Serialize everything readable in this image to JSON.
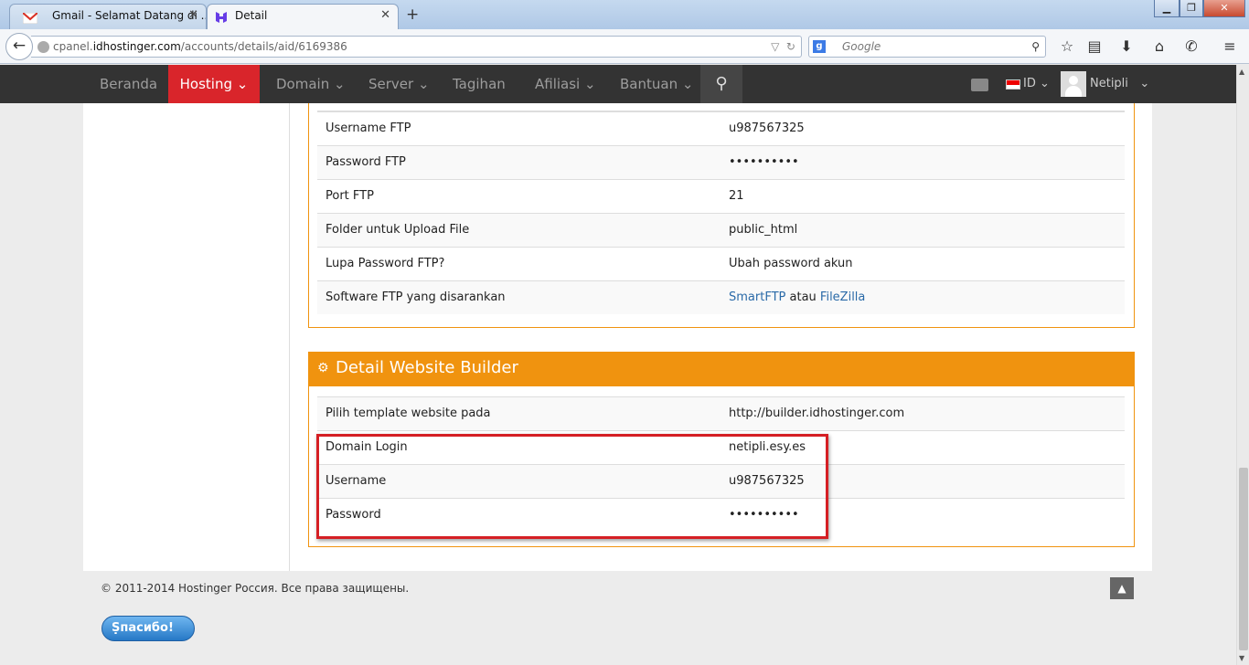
{
  "browser": {
    "tabs": [
      {
        "title": "Gmail - Selamat Datang di ...",
        "icon": "gmail-icon",
        "active": false
      },
      {
        "title": "Detail",
        "icon": "hostinger-icon",
        "active": true
      }
    ],
    "url": {
      "prefix": "cpanel.",
      "domain": "idhostinger.com",
      "path": "/accounts/details/aid/6169386"
    },
    "search_placeholder": "Google"
  },
  "sitenav": {
    "items": [
      {
        "label": "Beranda",
        "dropdown": false
      },
      {
        "label": "Hosting",
        "dropdown": true,
        "active": true
      },
      {
        "label": "Domain",
        "dropdown": true
      },
      {
        "label": "Server",
        "dropdown": true
      },
      {
        "label": "Tagihan",
        "dropdown": false
      },
      {
        "label": "Afiliasi",
        "dropdown": true
      },
      {
        "label": "Bantuan",
        "dropdown": true
      }
    ],
    "language": "ID",
    "username": "Netipli",
    "accent": "#d9252b"
  },
  "ftp": {
    "rows": [
      {
        "label": "Username FTP",
        "value": "u987567325"
      },
      {
        "label": "Password FTP",
        "value": "••••••••••"
      },
      {
        "label": "Port FTP",
        "value": "21"
      },
      {
        "label": "Folder untuk Upload File",
        "value": "public_html"
      },
      {
        "label": "Lupa Password FTP?",
        "value": "Ubah password akun"
      },
      {
        "label": "Software FTP yang disarankan",
        "link1": "SmartFTP",
        "sep": "atau",
        "link2": "FileZilla"
      }
    ]
  },
  "website_builder": {
    "title": "Detail Website Builder",
    "header_color": "#f0930f",
    "rows": [
      {
        "label": "Pilih template website pada",
        "value": "http://builder.idhostinger.com"
      },
      {
        "label": "Domain Login",
        "value": "netipli.esy.es"
      },
      {
        "label": "Username",
        "value": "u987567325"
      },
      {
        "label": "Password",
        "value": "••••••••••"
      }
    ]
  },
  "footer": {
    "copyright": "© 2011-2014 Hostinger Россия. Все права защищены.",
    "badge": "Spasibo!"
  }
}
